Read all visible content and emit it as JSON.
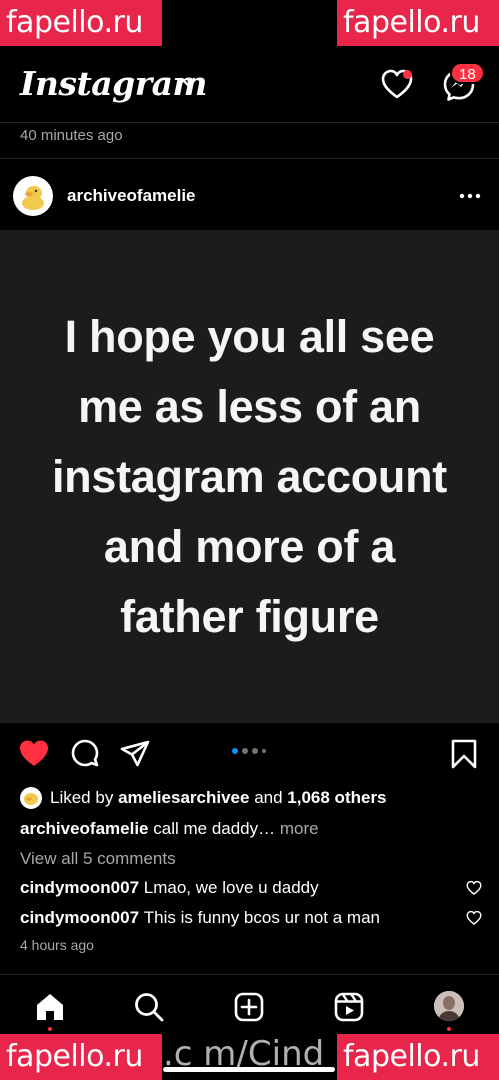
{
  "watermarks": [
    "fapello.ru",
    "fapello.ru",
    "fapello.ru",
    "fapello.ru"
  ],
  "watermark_bottom_url": ".c m/Cind",
  "header": {
    "logo": "Instagram",
    "messages_badge": "18"
  },
  "previous_post_time": "40 minutes ago",
  "post": {
    "username": "archiveofamelie",
    "image_text": [
      "I hope you all see",
      "me as less of an",
      "instagram account",
      "and more of a",
      "father figure"
    ],
    "liked_by_prefix": "Liked by",
    "liked_by_user": "ameliesarchivee",
    "liked_by_and": "and",
    "liked_by_others": "1,068 others",
    "caption_user": "archiveofamelie",
    "caption_text": "call me daddy…",
    "caption_more": "more",
    "view_all_comments": "View all 5 comments",
    "comments": [
      {
        "user": "cindymoon007",
        "text": "Lmao, we love u daddy"
      },
      {
        "user": "cindymoon007",
        "text": "This is funny bcos ur not a man"
      }
    ],
    "time": "4 hours ago"
  },
  "colors": {
    "background": "#000000",
    "like_red": "#ff3040",
    "carousel_active": "#0095f6",
    "muted_text": "#a8a8a8",
    "watermark": "#e8254a"
  },
  "icons": [
    "chevron-down-icon",
    "heart-icon",
    "messenger-icon",
    "more-icon",
    "like-icon",
    "comment-icon",
    "share-icon",
    "save-icon",
    "home-icon",
    "search-icon",
    "create-icon",
    "reels-icon"
  ]
}
